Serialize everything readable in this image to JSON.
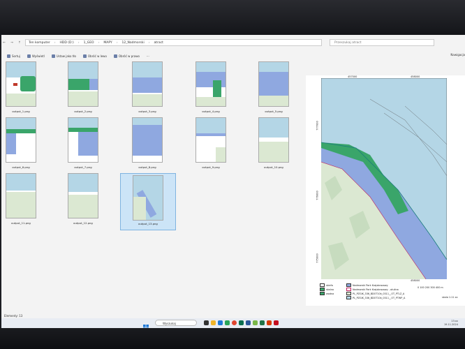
{
  "window": {
    "breadcrumbs": [
      "Ten komputer",
      "HDD (D:)",
      "1_GEO",
      "MAPY",
      "12_Nadmorski",
      "atract"
    ],
    "search_placeholder": "Przeszukaj atract",
    "toolbar": [
      "Sortuj",
      "Wyświetl",
      "Ustaw jako tło",
      "Obróć w lewo",
      "Obróć w prawo"
    ],
    "toolbar_right": "Nawigacja",
    "status": "Elementy: 13"
  },
  "thumbnails": [
    {
      "name": "output_1.png"
    },
    {
      "name": "output_2.png"
    },
    {
      "name": "output_3.png"
    },
    {
      "name": "output_4.png"
    },
    {
      "name": "output_5.png"
    },
    {
      "name": "output_6.png"
    },
    {
      "name": "output_7.png"
    },
    {
      "name": "output_8.png"
    },
    {
      "name": "output_9.png"
    },
    {
      "name": "output_10.png"
    },
    {
      "name": "output_11.png"
    },
    {
      "name": "output_12.png"
    },
    {
      "name": "output_13.png"
    }
  ],
  "preview": {
    "coords_top": [
      "457000",
      "458000"
    ],
    "coords_left": [
      "777000",
      "776000",
      "775000"
    ],
    "coords_bottom": [
      "458000"
    ],
    "scale_text": "0  100  200  300  400 m",
    "legend": [
      {
        "label": "strefa",
        "color": "#ffffff"
      },
      {
        "label": "skalna",
        "color": "#3aa56a"
      },
      {
        "label": "wodna",
        "color": "#3aa56a"
      },
      {
        "label": "Nadmorski Park Krajobrazowy",
        "color": "#8fa8e0"
      },
      {
        "label": "Nadmorski Park Krajobrazowy - otulina",
        "color": "#ffffff"
      },
      {
        "label": "PL_PZGIK_336_BDOT10k_0311__OT_PTLZ_A",
        "color": "#dbe8d2"
      },
      {
        "label": "PL_PZGIK_336_BDOT10k_0311__OT_PTWP_A",
        "color": "#b4d6e6"
      }
    ],
    "scale_note": "skala 1:11 xx"
  },
  "taskbar": {
    "search_label": "Wyszukaj",
    "time": "13:xx",
    "date": "19.11.2024"
  }
}
